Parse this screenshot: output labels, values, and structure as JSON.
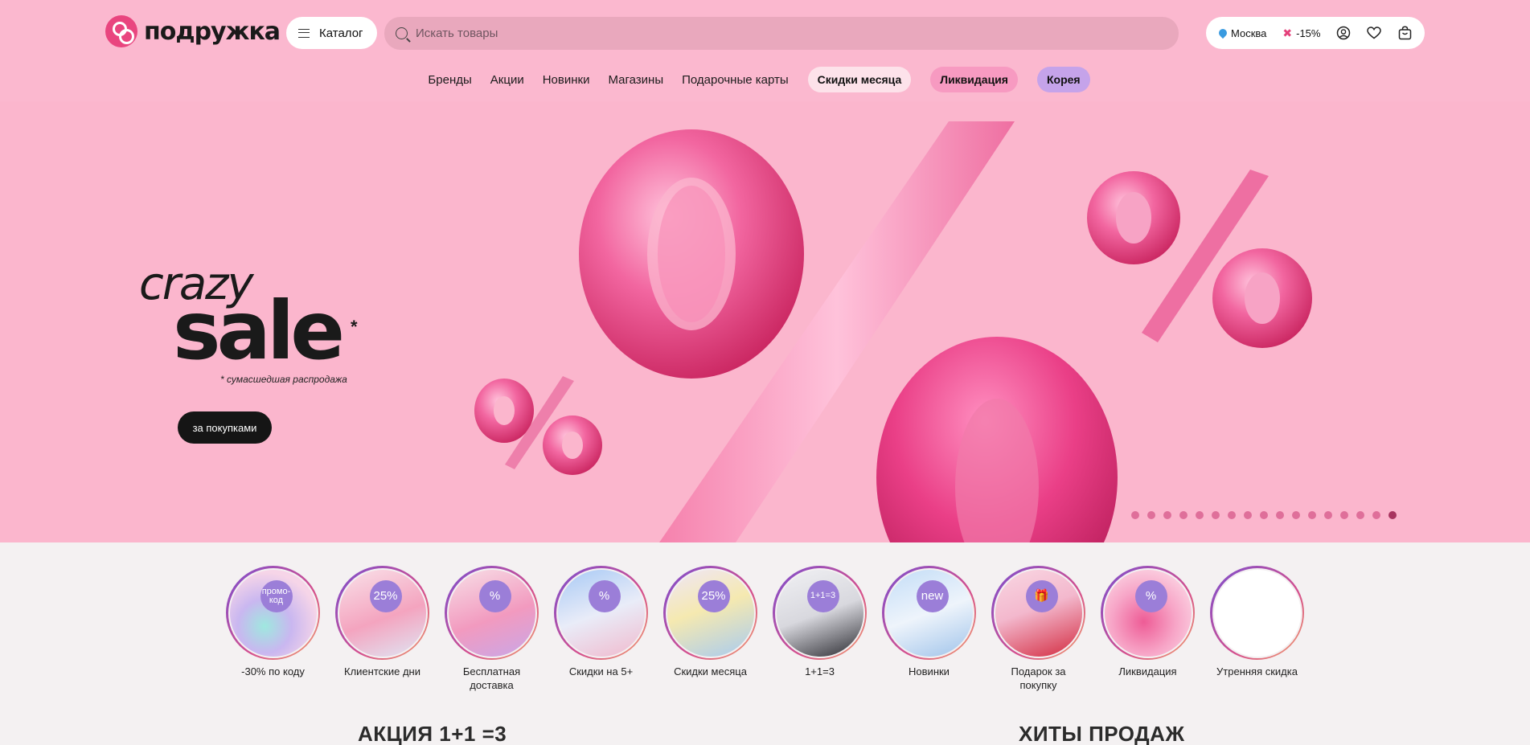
{
  "logo": {
    "text": "подружка"
  },
  "header": {
    "catalog_label": "Каталог",
    "search_placeholder": "Искать товары",
    "city": "Москва",
    "discount": "-15%"
  },
  "nav": {
    "items": [
      "Бренды",
      "Акции",
      "Новинки",
      "Магазины",
      "Подарочные карты"
    ],
    "pills": [
      "Скидки месяца",
      "Ликвидация",
      "Корея"
    ]
  },
  "hero": {
    "title_top": "crazy",
    "title_main": "sale",
    "asterisk": "*",
    "note": "* сумасшедшая распродажа",
    "button": "за покупками",
    "slides_total": 17,
    "active_slide": 17
  },
  "stories": [
    {
      "badge": "промо-код",
      "label": "-30% по кодy"
    },
    {
      "badge": "25%",
      "label": "Клиентские дни"
    },
    {
      "badge": "%",
      "label": "Бесплатная доставка"
    },
    {
      "badge": "%",
      "label": "Скидки на 5+"
    },
    {
      "badge": "25%",
      "label": "Скидки месяца"
    },
    {
      "badge": "1+1=3",
      "label": "1+1=3"
    },
    {
      "badge": "new",
      "label": "Новинки"
    },
    {
      "badge": "🎁",
      "label": "Подарок за покупку"
    },
    {
      "badge": "%",
      "label": "Ликвидация"
    },
    {
      "badge": "",
      "label": "Утренняя скидка"
    }
  ],
  "sections": {
    "promo_title": "АКЦИЯ 1+1 =3",
    "hits_title": "ХИТЫ ПРОДАЖ"
  },
  "colors": {
    "hero_bg": "#fbb6cd",
    "accent": "#e9457f"
  }
}
